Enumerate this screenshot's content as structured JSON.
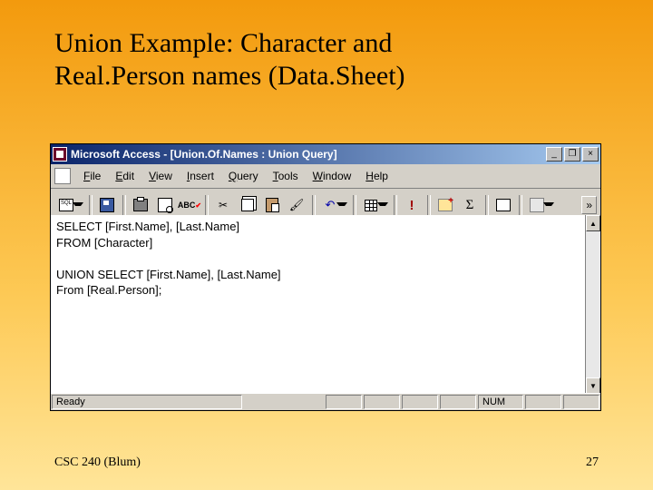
{
  "slide": {
    "title_line1": "Union Example: Character and",
    "title_line2": "Real.Person names (Data.Sheet)",
    "footer_left": "CSC 240 (Blum)",
    "footer_right": "27"
  },
  "window": {
    "title": "Microsoft Access - [Union.Of.Names : Union Query]",
    "controls": {
      "minimize": "_",
      "restore": "❐",
      "close": "×"
    }
  },
  "menu": {
    "items": [
      "File",
      "Edit",
      "View",
      "Insert",
      "Query",
      "Tools",
      "Window",
      "Help"
    ]
  },
  "toolbar": {
    "chevron": "»"
  },
  "sql": {
    "line1": "SELECT [First.Name], [Last.Name]",
    "line2": "FROM [Character]",
    "line3": "",
    "line4": "UNION SELECT [First.Name], [Last.Name]",
    "line5": "From [Real.Person];"
  },
  "statusbar": {
    "ready": "Ready",
    "num": "NUM"
  }
}
